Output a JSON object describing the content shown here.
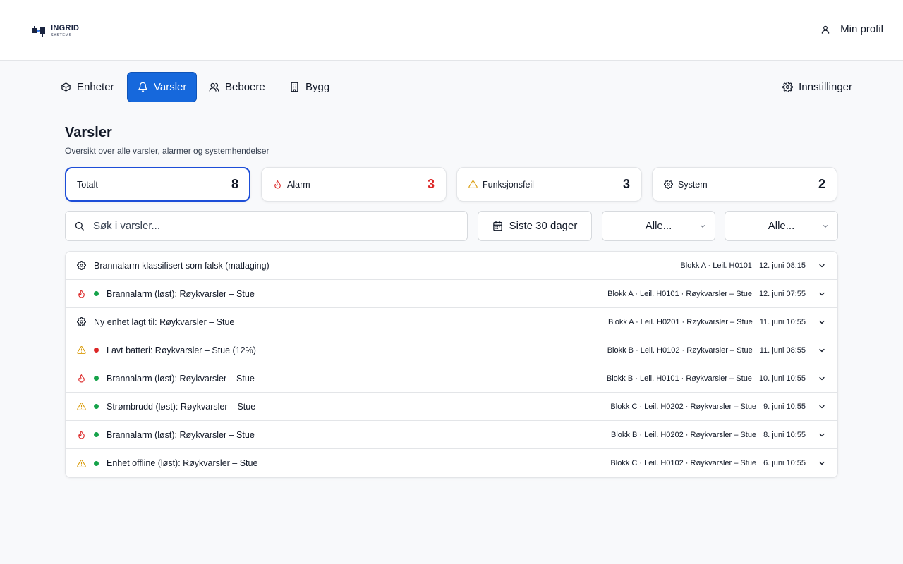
{
  "brand": {
    "name": "INGRID",
    "sub": "SYSTEMS"
  },
  "header": {
    "profile_label": "Min profil"
  },
  "nav": {
    "items": [
      {
        "label": "Enheter",
        "icon": "box-icon"
      },
      {
        "label": "Varsler",
        "icon": "bell-icon",
        "active": true
      },
      {
        "label": "Beboere",
        "icon": "users-icon"
      },
      {
        "label": "Bygg",
        "icon": "building-icon"
      }
    ],
    "settings_label": "Innstillinger"
  },
  "page": {
    "title": "Varsler",
    "subtitle": "Oversikt over alle varsler, alarmer og systemhendelser"
  },
  "stats": [
    {
      "label": "Totalt",
      "value": "8"
    },
    {
      "label": "Alarm",
      "value": "3"
    },
    {
      "label": "Funksjonsfeil",
      "value": "3"
    },
    {
      "label": "System",
      "value": "2"
    }
  ],
  "filters": {
    "search_placeholder": "Søk i varsler...",
    "date_range": "Siste 30 dager",
    "select_1": "Alle...",
    "select_2": "Alle..."
  },
  "colors": {
    "accent": "#1668dc",
    "alarm_red": "#dc2626",
    "warning_amber": "#d99a06",
    "resolved_green": "#16a34a",
    "active_red": "#dc2626"
  },
  "alerts": [
    {
      "type": "system",
      "status": "none",
      "title": "Brannalarm klassifisert som falsk (matlaging)",
      "location": "Blokk A · Leil. H0101",
      "time": "12. juni 08:15"
    },
    {
      "type": "alarm",
      "status": "resolved",
      "title": "Brannalarm (løst): Røykvarsler – Stue",
      "location": "Blokk A · Leil. H0101 · Røykvarsler – Stue",
      "time": "12. juni 07:55"
    },
    {
      "type": "system",
      "status": "none",
      "title": "Ny enhet lagt til: Røykvarsler – Stue",
      "location": "Blokk A · Leil. H0201 · Røykvarsler – Stue",
      "time": "11. juni 10:55"
    },
    {
      "type": "fault",
      "status": "active",
      "title": "Lavt batteri: Røykvarsler – Stue (12%)",
      "location": "Blokk B · Leil. H0102 · Røykvarsler – Stue",
      "time": "11. juni 08:55"
    },
    {
      "type": "alarm",
      "status": "resolved",
      "title": "Brannalarm (løst): Røykvarsler – Stue",
      "location": "Blokk B · Leil. H0101 · Røykvarsler – Stue",
      "time": "10. juni 10:55"
    },
    {
      "type": "fault",
      "status": "resolved",
      "title": "Strømbrudd (løst): Røykvarsler – Stue",
      "location": "Blokk C · Leil. H0202 · Røykvarsler – Stue",
      "time": "9. juni 10:55"
    },
    {
      "type": "alarm",
      "status": "resolved",
      "title": "Brannalarm (løst): Røykvarsler – Stue",
      "location": "Blokk B · Leil. H0202 · Røykvarsler – Stue",
      "time": "8. juni 10:55"
    },
    {
      "type": "fault",
      "status": "resolved",
      "title": "Enhet offline (løst): Røykvarsler – Stue",
      "location": "Blokk C · Leil. H0102 · Røykvarsler – Stue",
      "time": "6. juni 10:55"
    }
  ]
}
